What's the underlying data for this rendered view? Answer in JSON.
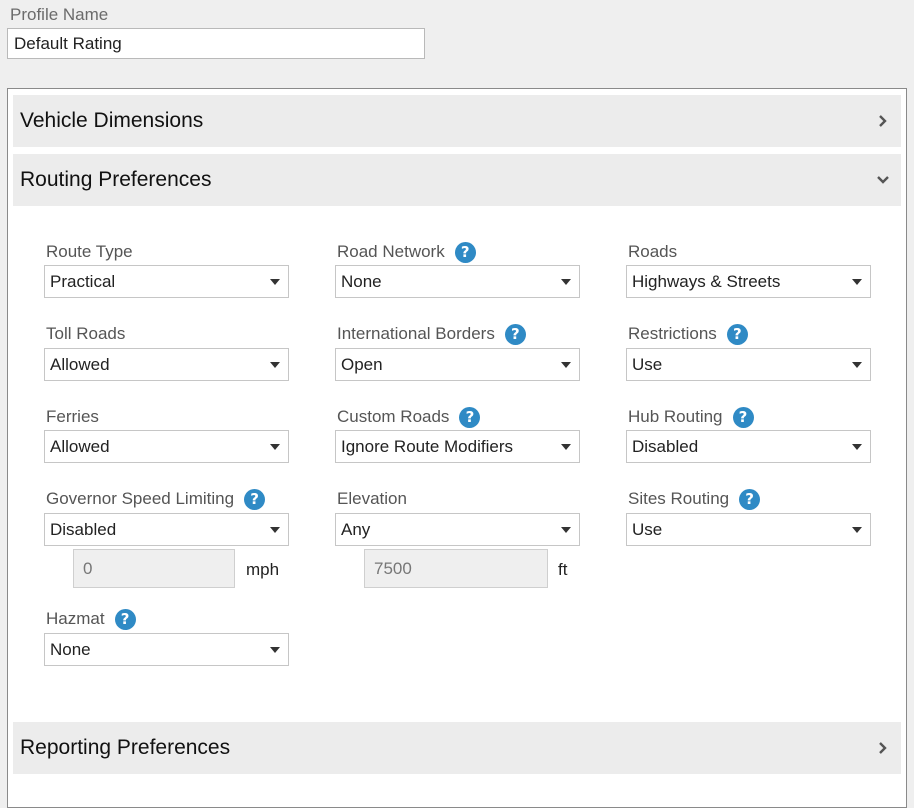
{
  "profile": {
    "label": "Profile Name",
    "value": "Default Rating"
  },
  "sections": {
    "vehicle_dimensions": {
      "title": "Vehicle Dimensions",
      "expanded": false
    },
    "routing_preferences": {
      "title": "Routing Preferences",
      "expanded": true
    },
    "reporting_preferences": {
      "title": "Reporting Preferences",
      "expanded": false
    }
  },
  "routing": {
    "route_type": {
      "label": "Route Type",
      "value": "Practical",
      "help": false
    },
    "road_network": {
      "label": "Road Network",
      "value": "None",
      "help": true
    },
    "roads": {
      "label": "Roads",
      "value": "Highways & Streets",
      "help": false
    },
    "toll_roads": {
      "label": "Toll Roads",
      "value": "Allowed",
      "help": false
    },
    "international_borders": {
      "label": "International Borders",
      "value": "Open",
      "help": true
    },
    "restrictions": {
      "label": "Restrictions",
      "value": "Use",
      "help": true
    },
    "ferries": {
      "label": "Ferries",
      "value": "Allowed",
      "help": false
    },
    "custom_roads": {
      "label": "Custom Roads",
      "value": "Ignore Route Modifiers",
      "help": true
    },
    "hub_routing": {
      "label": "Hub Routing",
      "value": "Disabled",
      "help": true
    },
    "governor_speed_limiting": {
      "label": "Governor Speed Limiting",
      "value": "Disabled",
      "help": true,
      "speed_value": "0",
      "speed_unit": "mph"
    },
    "elevation": {
      "label": "Elevation",
      "value": "Any",
      "help": false,
      "elevation_value": "7500",
      "elevation_unit": "ft"
    },
    "sites_routing": {
      "label": "Sites Routing",
      "value": "Use",
      "help": true
    },
    "hazmat": {
      "label": "Hazmat",
      "value": "None",
      "help": true
    }
  },
  "icons": {
    "help": "?",
    "chevron_right": "chevron-right",
    "chevron_down": "chevron-down",
    "dropdown": "caret-down"
  },
  "colors": {
    "help_icon": "#2f8ac5",
    "section_header_bg": "#ececec",
    "page_bg": "#efefef"
  }
}
